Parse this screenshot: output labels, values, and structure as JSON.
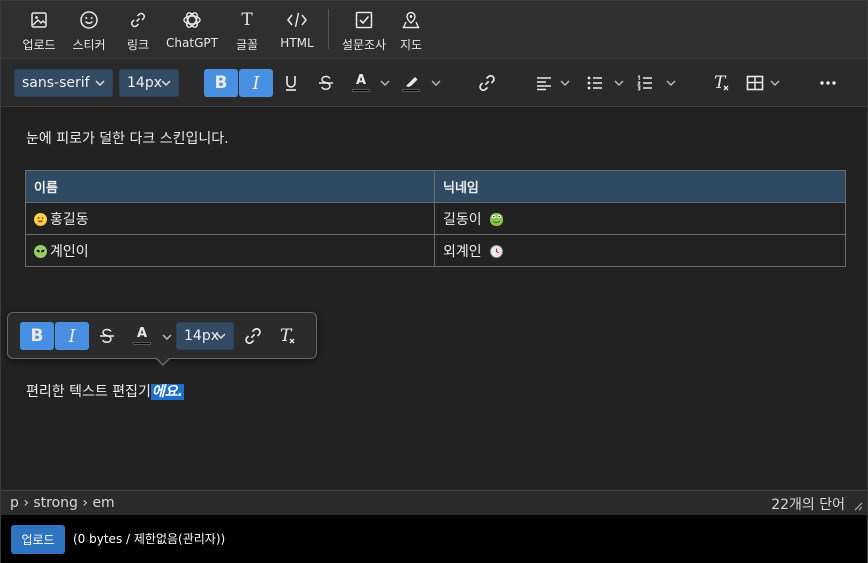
{
  "menubar": {
    "items": [
      {
        "label": "업로드",
        "icon": "image-icon"
      },
      {
        "label": "스티커",
        "icon": "smiley-icon"
      },
      {
        "label": "링크",
        "icon": "link-icon"
      },
      {
        "label": "ChatGPT",
        "icon": "chatgpt-icon"
      },
      {
        "label": "글꼴",
        "icon": "font-icon"
      },
      {
        "label": "HTML",
        "icon": "code-icon"
      },
      {
        "label": "설문조사",
        "icon": "checkbox-icon"
      },
      {
        "label": "지도",
        "icon": "map-icon"
      }
    ]
  },
  "toolbar": {
    "font_family": "sans-serif",
    "font_size": "14px",
    "bold_label": "B",
    "italic_label": "I",
    "color_label": "A",
    "clear_label": "T"
  },
  "content": {
    "intro": "눈에 피로가 덜한 다크 스킨입니다.",
    "table": {
      "headers": [
        "이름",
        "닉네임"
      ],
      "rows": [
        {
          "name": "홍길동",
          "nick": "길동이"
        },
        {
          "name": "계인이",
          "nick": "외계인"
        }
      ]
    },
    "para_plain": "편리한 텍스트 편집기",
    "para_selected": "에요."
  },
  "float_toolbar": {
    "bold_label": "B",
    "italic_label": "I",
    "color_label": "A",
    "font_size": "14px",
    "clear_label": "T"
  },
  "status": {
    "path": "p › strong › em",
    "word_count": "22개의 단어"
  },
  "upload": {
    "button_label": "업로드",
    "info": "(0 bytes / 제한없음(관리자))"
  },
  "colors": {
    "accent": "#4a90e2",
    "header_bg": "#2f4a63",
    "selection": "#1f6fd1"
  }
}
